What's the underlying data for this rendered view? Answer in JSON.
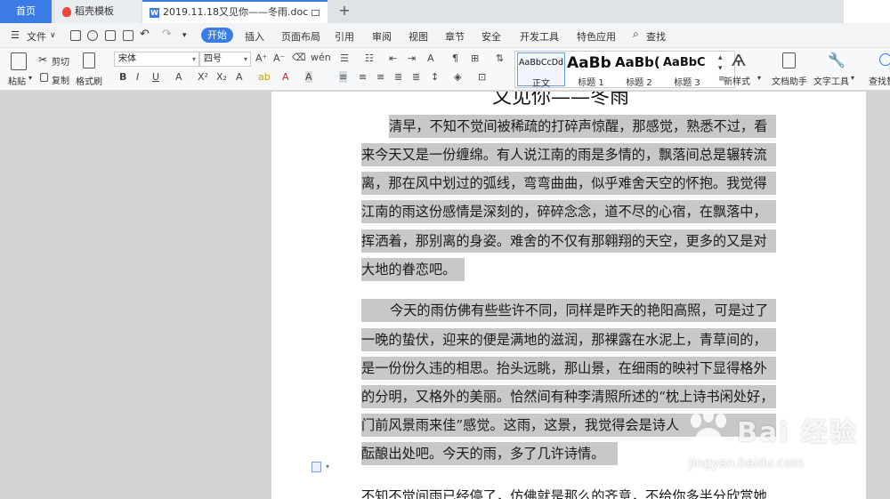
{
  "tabs": {
    "home": "首页",
    "template": "稻壳模板",
    "document": "2019.11.18又见你——冬雨.doc",
    "add": "+"
  },
  "menu": {
    "file": "文件",
    "items": [
      "开始",
      "插入",
      "页面布局",
      "引用",
      "审阅",
      "视图",
      "章节",
      "安全",
      "开发工具",
      "特色应用"
    ],
    "search": "查找"
  },
  "ribbon": {
    "paste": "粘贴",
    "cut": "剪切",
    "copy": "复制",
    "format_painter": "格式刷",
    "font_name": "宋体",
    "font_size": "四号",
    "styles": [
      {
        "sample": "AaBbCcDd",
        "name": "正文"
      },
      {
        "sample": "AaBb",
        "name": "标题 1"
      },
      {
        "sample": "AaBb(",
        "name": "标题 2"
      },
      {
        "sample": "AaBbC",
        "name": "标题 3"
      }
    ],
    "new_style": "新样式",
    "doc_helper": "文档助手",
    "text_tools": "文字工具",
    "find_replace": "查找替"
  },
  "document": {
    "title": "又见你——冬雨",
    "lines": [
      "清早，不知不觉间被稀疏的打碎声惊醒，那感觉，熟悉不过，看",
      "来今天又是一份缠绵。有人说江南的雨是多情的，飘落间总是辗转流",
      "离，那在风中划过的弧线，弯弯曲曲，似乎难舍天空的怀抱。我觉得",
      "江南的雨这份感情是深刻的，碎碎念念，道不尽的心宿，在飘落中，",
      "挥洒着，那别离的身姿。难舍的不仅有那翱翔的天空，更多的又是对",
      "大地的眷恋吧。",
      "今天的雨仿佛有些些许不同，同样是昨天的艳阳高照，可是过了",
      "一晚的蛰伏，迎来的便是满地的滋润，那裸露在水泥上，青草间的，",
      "是一份份久违的相思。抬头远眺，那山景，在细雨的映衬下显得格外",
      "的分明，又格外的美丽。恰然间有种李清照所述的“枕上诗书闲处好，",
      "门前风景雨来佳”感觉。这雨，这景，我觉得会是诗人",
      "酝酿出处吧。今天的雨，多了几许诗情。",
      "不知不觉间雨已经停了，仿佛就是那么的齐意，不给你多半分欣赏她"
    ]
  },
  "watermark": {
    "brand": "Bai 经验",
    "url": "jingyan.baidu.com"
  }
}
